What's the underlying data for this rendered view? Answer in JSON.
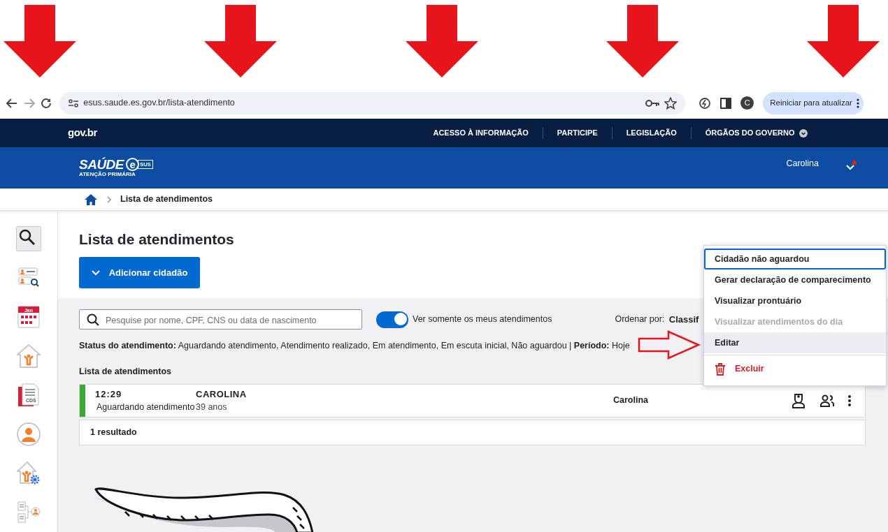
{
  "browser": {
    "url": "esus.saude.es.gov.br/lista-atendimento",
    "profile_initial": "C",
    "update_button": "Reiniciar para atualizar"
  },
  "gov_bar": {
    "logo": "gov.br",
    "links": [
      {
        "label": "ACESSO À INFORMAÇÃO",
        "dropdown": false
      },
      {
        "label": "PARTICIPE",
        "dropdown": false
      },
      {
        "label": "LEGISLAÇÃO",
        "dropdown": false
      },
      {
        "label": "ÓRGÃOS DO GOVERNO",
        "dropdown": true
      }
    ]
  },
  "header": {
    "logo": "SAÚDE",
    "logo_badge_letter": "e",
    "logo_badge": "SUS",
    "logo_subtitle": "ATENÇÃO PRIMÁRIA",
    "user": "Carolina",
    "notification": true
  },
  "breadcrumb": {
    "items": [
      "Lista de atendimentos"
    ]
  },
  "sidebar": {
    "items": [
      {
        "kind": "search",
        "selected": true
      },
      {
        "kind": "cards-search",
        "selected": false
      },
      {
        "kind": "calendar",
        "label": "Jan",
        "selected": false
      },
      {
        "kind": "home-person",
        "selected": false
      },
      {
        "kind": "document",
        "label": "CDS",
        "selected": false
      },
      {
        "kind": "person",
        "selected": false
      },
      {
        "kind": "home-gear",
        "selected": false
      },
      {
        "kind": "tree-person",
        "selected": false
      }
    ]
  },
  "page": {
    "title": "Lista de atendimentos",
    "add_button": "Adicionar cidadão",
    "search": {
      "placeholder": "Pesquise por nome, CPF, CNS ou data de nascimento"
    },
    "toggle": {
      "label": "Ver somente os meus atendimentos",
      "on": true
    },
    "sort": {
      "label": "Ordenar por:",
      "value": "Classif"
    },
    "filter_summary": "**Status do atendimento:** Aguardando atendimento, Atendimento realizado, Em atendimento, Em escuta inicial, Não aguardou | **Período:** Hoje",
    "list_heading": "Lista de atendimentos",
    "rows": [
      {
        "time": "12:29",
        "status": "Aguardando atendimento",
        "color": "#3aa935",
        "name": "CAROLINA",
        "age": "39 anos",
        "professional": "Carolina"
      }
    ],
    "result_count": "1 resultado"
  },
  "menu": {
    "items": [
      {
        "label": "Cidadão não aguardou",
        "kind": "action",
        "focused": true,
        "hovered": false,
        "disabled": false
      },
      {
        "label": "Gerar declaração de comparecimento",
        "kind": "action",
        "focused": false,
        "hovered": false,
        "disabled": false
      },
      {
        "label": "Visualizar prontuário",
        "kind": "action",
        "focused": false,
        "hovered": false,
        "disabled": false
      },
      {
        "label": "Visualizar atendimentos do dia",
        "kind": "action",
        "focused": false,
        "hovered": false,
        "disabled": true
      },
      {
        "label": "Editar",
        "kind": "action",
        "focused": false,
        "hovered": true,
        "disabled": false
      },
      {
        "label": "Excluir",
        "kind": "danger",
        "focused": false,
        "hovered": false,
        "disabled": false
      }
    ]
  }
}
